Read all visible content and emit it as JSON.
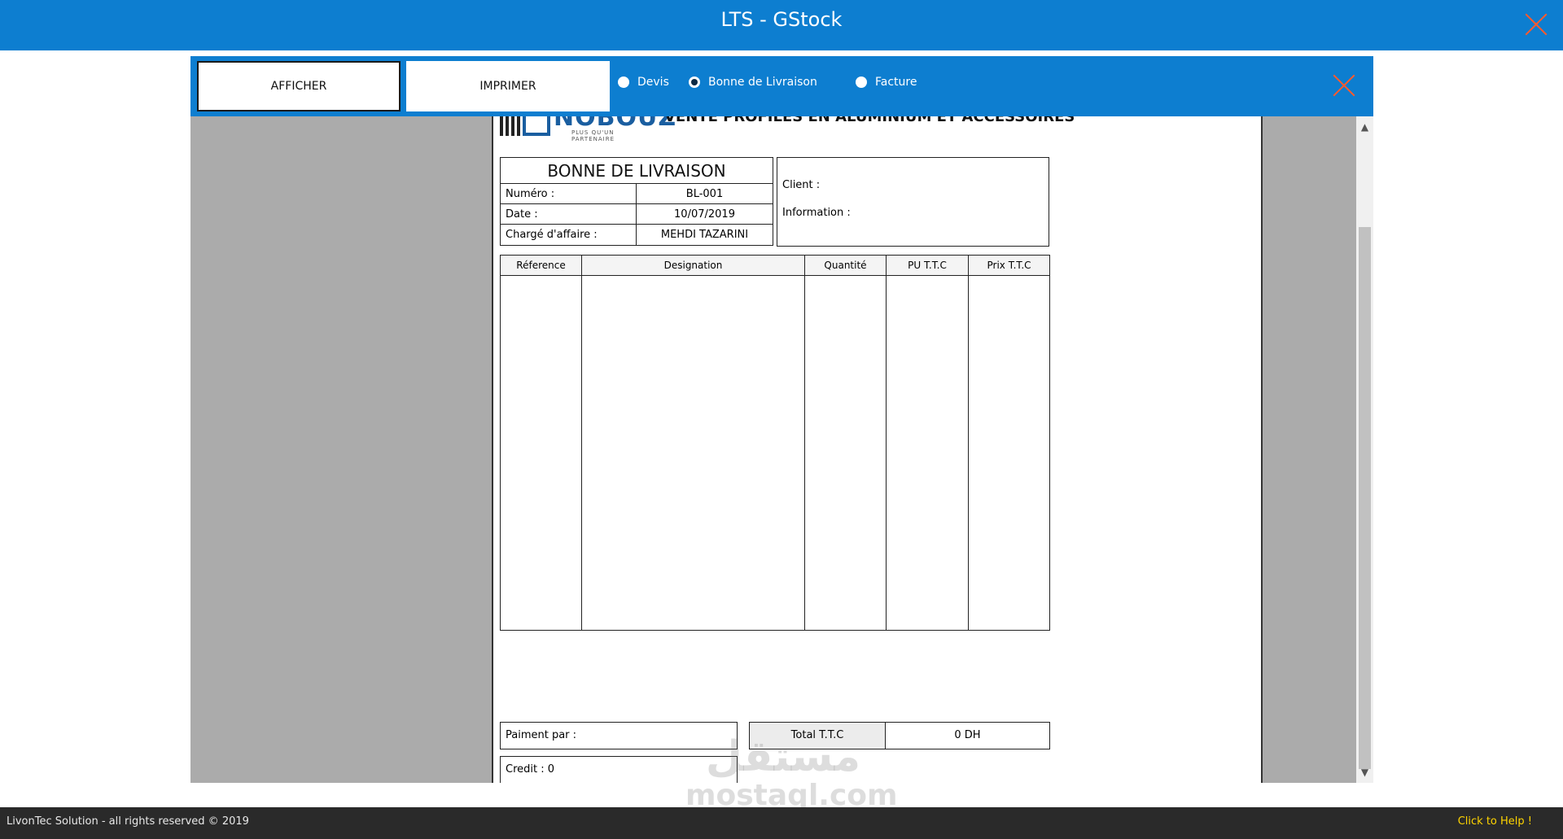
{
  "window": {
    "title": "LTS - GStock"
  },
  "toolbar": {
    "afficher_label": "AFFICHER",
    "imprimer_label": "IMPRIMER",
    "radios": [
      {
        "label": "Devis",
        "checked": false
      },
      {
        "label": "Bonne de Livraison",
        "checked": true
      },
      {
        "label": "Facture",
        "checked": false
      }
    ]
  },
  "document": {
    "logo_text": "NOBOUZ",
    "logo_subtitle": "PLUS QU'UN PARTENAIRE",
    "slogan": "VENTE PROFILES EN ALUMINIUM ET ACCESSOIRES",
    "title": "BONNE DE LIVRAISON",
    "info_rows": [
      {
        "label": "Numéro :",
        "value": "BL-001"
      },
      {
        "label": "Date :",
        "value": "10/07/2019"
      },
      {
        "label": "Chargé d'affaire :",
        "value": "MEHDI TAZARINI"
      }
    ],
    "client_label": "Client :",
    "information_label": "Information :",
    "columns": [
      "Réference",
      "Designation",
      "Quantité",
      "PU T.T.C",
      "Prix T.T.C"
    ],
    "paiment_label": "Paiment par :",
    "credit_label": "Credit : 0",
    "total_label": "Total T.T.C",
    "total_value": "0  DH"
  },
  "footer": {
    "copyright": "LivonTec Solution - all rights reserved © 2019",
    "help": "Click to Help !"
  },
  "watermark": {
    "arabic": "مستقل",
    "latin": "mostaql.com"
  },
  "colors": {
    "primary": "#0d7ed0",
    "close": "#ff5a2a",
    "footer": "#2a2a2a",
    "help": "#ffd400"
  }
}
